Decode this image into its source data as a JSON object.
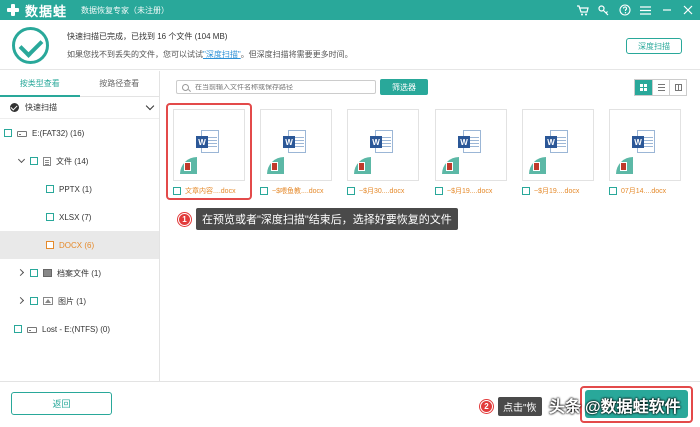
{
  "app": {
    "logo_text": "数据蛙",
    "title": "数据恢复专家（未注册）"
  },
  "status": {
    "line1": "快速扫描已完成，已找到 16 个文件 (104 MB)",
    "line2_before": "如果您找不到丢失的文件，您可以试试",
    "line2_link": "\"深度扫描\"",
    "line2_after": "。但深度扫描将需要更多时间。",
    "deep_scan_label": "深度扫描"
  },
  "sidebar": {
    "tabs": [
      {
        "label": "按类型查看",
        "active": true
      },
      {
        "label": "按路径查看",
        "active": false
      }
    ],
    "quick_scan_label": "快速扫描",
    "tree": [
      {
        "label": "E:(FAT32) (16)"
      },
      {
        "label": "文件 (14)"
      },
      {
        "label": "PPTX (1)"
      },
      {
        "label": "XLSX (7)"
      },
      {
        "label": "DOCX (6)"
      },
      {
        "label": "档案文件 (1)"
      },
      {
        "label": "图片 (1)"
      },
      {
        "label": "Lost - E:(NTFS) (0)"
      }
    ]
  },
  "toolbar": {
    "search_placeholder": "在当前输入文件名称或保存路径",
    "filter_label": "筛选器"
  },
  "files": [
    {
      "name": "文章内容....docx",
      "icon": "word-icon"
    },
    {
      "name": "~$喂鱼教....docx",
      "icon": "word-icon"
    },
    {
      "name": "~$月30....docx",
      "icon": "word-icon"
    },
    {
      "name": "~$月19....docx",
      "icon": "word-icon"
    },
    {
      "name": "~$月19....docx",
      "icon": "word-icon"
    },
    {
      "name": "07月14....docx",
      "icon": "word-icon"
    }
  ],
  "annotations": [
    {
      "number": "1",
      "text": "在预览或者\"深度扫描\"结束后，选择好要恢复的文件"
    },
    {
      "number": "2",
      "text": "点击\"恢"
    }
  ],
  "footer": {
    "back_label": "返回",
    "watermark_platform": "头条",
    "watermark_account": "@数据蛙软件"
  },
  "colors": {
    "accent": "#29a89a",
    "selected_text": "#e58a2b",
    "highlight": "#e34a4a"
  }
}
